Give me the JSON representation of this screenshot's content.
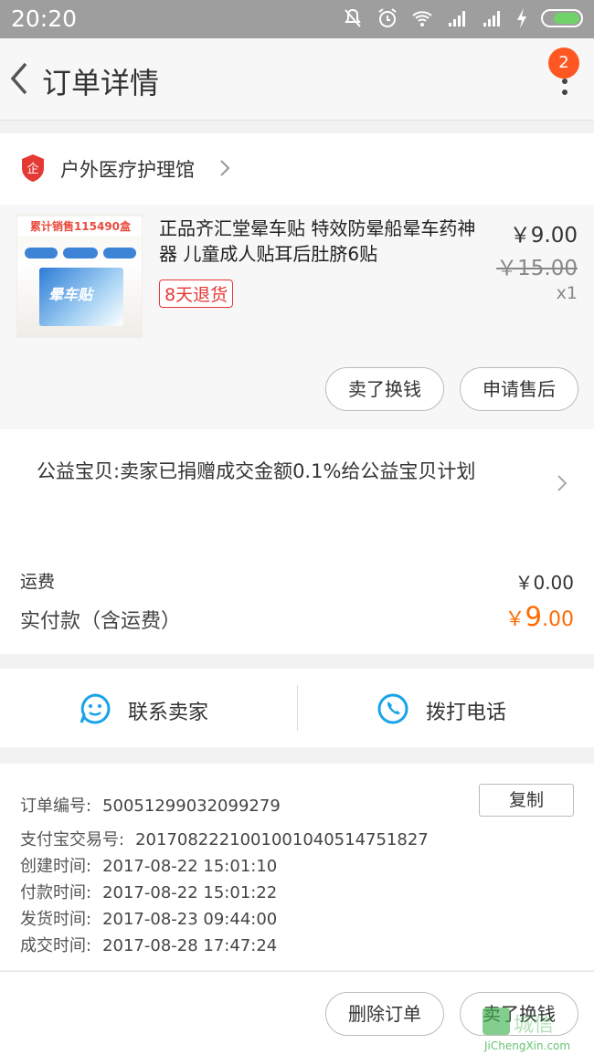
{
  "status_bar": {
    "time": "20:20"
  },
  "header": {
    "title": "订单详情",
    "badge_count": "2"
  },
  "shop": {
    "name": "户外医疗护理馆"
  },
  "product": {
    "image_banner": "累计销售115490盒",
    "image_box_text": "晕车贴",
    "title": "正品齐汇堂晕车贴 特效防晕船晕车药神器 儿童成人贴耳后肚脐6贴",
    "tag": "8天退货",
    "price": "￥9.00",
    "original_price": "￥15.00",
    "quantity": "x1",
    "buttons": {
      "sell": "卖了换钱",
      "after_sale": "申请售后"
    }
  },
  "charity": {
    "text": "公益宝贝:卖家已捐赠成交金额0.1%给公益宝贝计划"
  },
  "fees": {
    "shipping_label": "运费",
    "shipping_value": "￥0.00",
    "paid_label": "实付款（含运费）",
    "paid_currency": "￥",
    "paid_int": "9",
    "paid_dec": ".00"
  },
  "contact": {
    "seller": "联系卖家",
    "phone": "拨打电话"
  },
  "info": {
    "copy_label": "复制",
    "rows": [
      {
        "label": "订单编号:",
        "value": "50051299032099279"
      },
      {
        "label": "支付宝交易号:",
        "value": "2017082221001001040514751827"
      },
      {
        "label": "创建时间:",
        "value": "2017-08-22 15:01:10"
      },
      {
        "label": "付款时间:",
        "value": "2017-08-22 15:01:22"
      },
      {
        "label": "发货时间:",
        "value": "2017-08-23 09:44:00"
      },
      {
        "label": "成交时间:",
        "value": "2017-08-28 17:47:24"
      }
    ]
  },
  "footer": {
    "delete": "删除订单",
    "sell": "卖了换钱"
  },
  "watermark": {
    "text": "JiChengXin.com"
  },
  "colors": {
    "accent": "#ff6a00",
    "badge": "#ff5722",
    "tag": "#e53935",
    "contact_icon": "#1aa3e8"
  }
}
